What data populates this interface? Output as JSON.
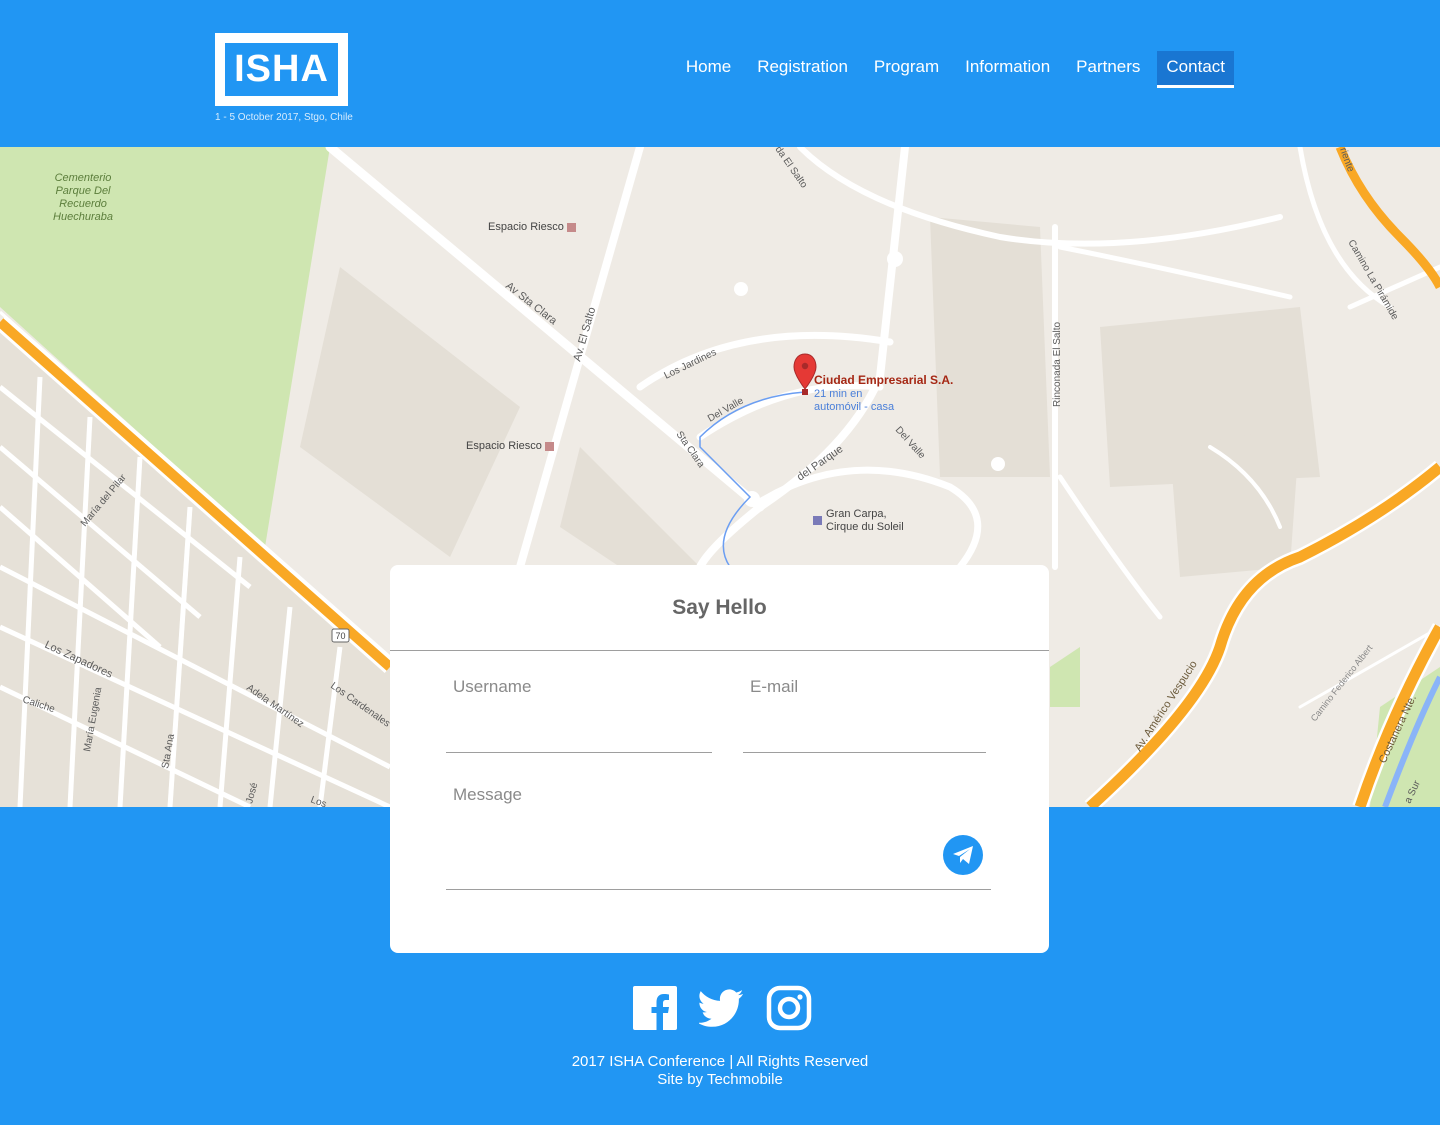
{
  "brand": {
    "logo_text": "ISHA",
    "tagline": "1 - 5 October 2017, Stgo, Chile"
  },
  "nav": {
    "items": [
      {
        "label": "Home"
      },
      {
        "label": "Registration"
      },
      {
        "label": "Program"
      },
      {
        "label": "Information"
      },
      {
        "label": "Partners"
      },
      {
        "label": "Contact",
        "active": true
      }
    ]
  },
  "map": {
    "labels": {
      "cemetery_1": "Cementerio",
      "cemetery_2": "Parque Del",
      "cemetery_3": "Recuerdo",
      "cemetery_4": "Huechuraba",
      "riesco_top": "Espacio Riesco",
      "riesco_mid": "Espacio Riesco",
      "av_sta_clara": "Av Sta Clara",
      "av_el_salto": "Av. El Salto",
      "los_jardines": "Los Jardines",
      "del_valle_left": "Del Valle",
      "del_valle_right": "Del Valle",
      "sta_clara": "Sta Clara",
      "del_parque": "del Parque",
      "gran_carpa_1": "Gran Carpa,",
      "gran_carpa_2": "Cirque du Soleil",
      "rinconada": "Rinconada El Salto",
      "el_salto_top": "da El Salto",
      "camino_piramide": "Camino La Pirámide",
      "oriente": "riente",
      "maria_pilar": "María del Pilar",
      "los_zapadores": "Los Zapadores",
      "caliche": "Caliche",
      "maria_eugenia": "María Eugenia",
      "sta_ana": "Sta Ana",
      "adela_martinez": "Adela Martínez",
      "los_cardenales": "Los Cardenales",
      "jose": "José",
      "los": "Los",
      "route_70": "70",
      "americo_vespucio": "Av. Américo Vespucio",
      "camino_federico": "Camino Federico Albert",
      "costanera": "Costanera Nte.",
      "sur": "a Sur"
    },
    "marker": {
      "name": "Ciudad Empresarial S.A.",
      "travel_1": "21 min en",
      "travel_2": "automóvil - casa"
    }
  },
  "contact": {
    "title": "Say Hello",
    "username_placeholder": "Username",
    "email_placeholder": "E-mail",
    "message_placeholder": "Message"
  },
  "footer": {
    "line1": "2017 ISHA Conference | All Rights Reserved",
    "line2": "Site by Techmobile"
  },
  "colors": {
    "primary": "#2196F3",
    "active_nav": "#1976D2",
    "highway": "#F9A825"
  }
}
